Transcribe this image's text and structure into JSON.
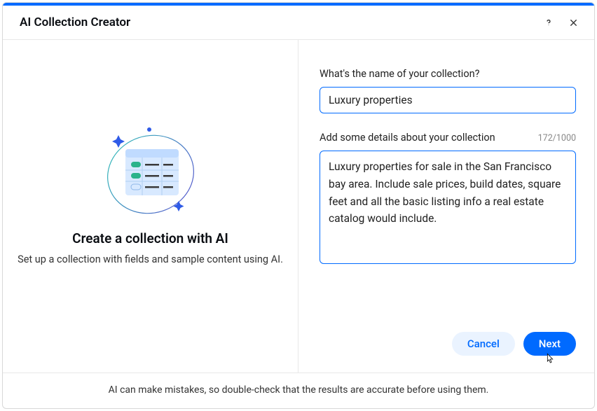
{
  "header": {
    "title": "AI Collection Creator"
  },
  "left": {
    "heading": "Create a collection with AI",
    "subheading": "Set up a collection with fields and sample content using AI."
  },
  "form": {
    "name_label": "What's the name of your collection?",
    "name_value": "Luxury properties",
    "details_label": "Add some details about your collection",
    "details_counter": "172/1000",
    "details_value": "Luxury properties for sale in the San Francisco bay area. Include sale prices, build dates, square feet and all the basic listing info a real estate catalog would include."
  },
  "buttons": {
    "cancel": "Cancel",
    "next": "Next"
  },
  "footer": {
    "disclaimer": "AI can make mistakes, so double-check that the results are accurate before using them."
  }
}
